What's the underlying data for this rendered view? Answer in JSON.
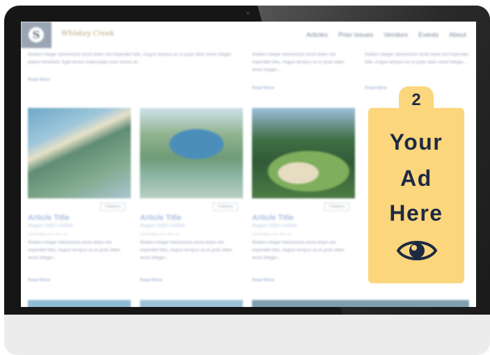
{
  "site": {
    "brand": "Whiskey Creek",
    "nav": [
      "Articles",
      "Prior Issues",
      "Vendors",
      "Events",
      "About"
    ]
  },
  "row1": {
    "texts": [
      "Nullam integer elementum amet etiam dui imperdiet felis. Augue tempus eu in justo diam amet integer platea hendrerit. Eget lectus malesuada nunc donec id...",
      "Nullam integer elementum amet etiam dui imperdiet felis. Augue tempus eu in justo diam amet integer...",
      "Nullam integer elementum amet etiam dui imperdiet felis. Augue tempus eu in justo diam amet integer..."
    ],
    "read_more": "Read More"
  },
  "articles": [
    {
      "category": "Category",
      "title": "Article Title",
      "meta": "August 2020 / Author",
      "sub": "subcategory one, two, etc",
      "excerpt": "Nullam integer elementum amet etiam dui imperdiet felis. Augue tempus eu in justo diam amet integer...",
      "read_more": "Read More"
    },
    {
      "category": "Category",
      "title": "Article Title",
      "meta": "August 2020 / Author",
      "sub": "subcategory one, two, etc",
      "excerpt": "Nullam integer elementum amet etiam dui imperdiet felis. Augue tempus eu in justo diam amet integer...",
      "read_more": "Read More"
    },
    {
      "category": "Category",
      "title": "Article Title",
      "meta": "August 2020 / Author",
      "sub": "subcategory one, two, etc",
      "excerpt": "Nullam integer elementum amet etiam dui imperdiet felis. Augue tempus eu in justo diam amet integer...",
      "read_more": "Read More"
    }
  ],
  "ad": {
    "number": "2",
    "lines": [
      "Your",
      "Ad",
      "Here"
    ],
    "icon": "eye-icon",
    "background_color": "#fbd67c",
    "text_color": "#1d2a44"
  }
}
